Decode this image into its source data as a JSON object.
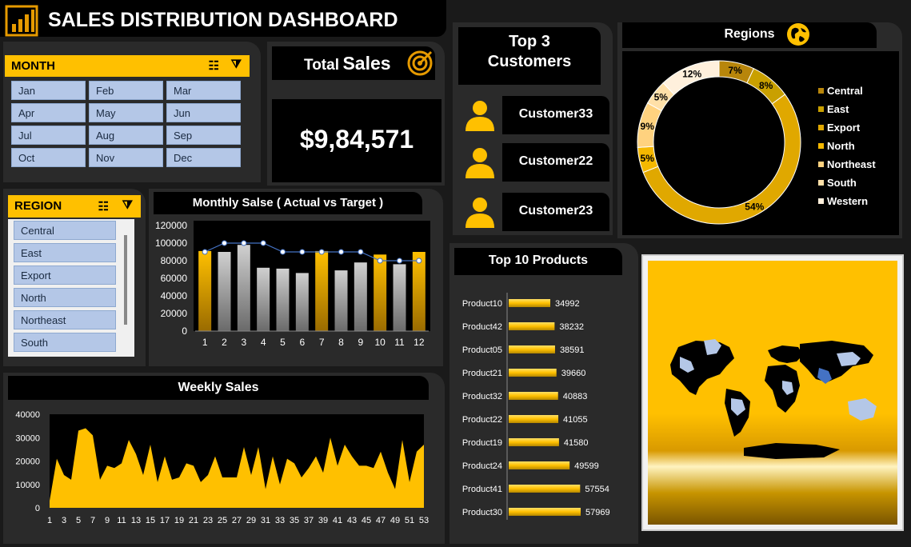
{
  "title": "SALES DISTRIBUTION DASHBOARD",
  "month_slicer": {
    "title": "MONTH",
    "items": [
      "Jan",
      "Feb",
      "Mar",
      "Apr",
      "May",
      "Jun",
      "Jul",
      "Aug",
      "Sep",
      "Oct",
      "Nov",
      "Dec"
    ]
  },
  "region_slicer": {
    "title": "REGION",
    "items": [
      "Central",
      "East",
      "Export",
      "North",
      "Northeast",
      "South"
    ]
  },
  "total_sales": {
    "label_small": "Total",
    "label_big": "Sales",
    "value": "$9,84,571"
  },
  "top_customers": {
    "title_line1": "Top 3",
    "title_line2": "Customers",
    "items": [
      "Customer33",
      "Customer22",
      "Customer23"
    ]
  },
  "regions": {
    "title": "Regions",
    "legend": [
      "Central",
      "East",
      "Export",
      "North",
      "Northeast",
      "South",
      "Western"
    ],
    "colors": [
      "#B8860B",
      "#C9A000",
      "#E0A800",
      "#F5B800",
      "#FFD27F",
      "#FFE0A8",
      "#FFF0DC"
    ]
  },
  "monthly": {
    "title": "Monthly Salse ( Actual vs Target )"
  },
  "weekly": {
    "title": "Weekly Sales"
  },
  "products": {
    "title": "Top 10 Products"
  },
  "chart_data": [
    {
      "type": "pie",
      "title": "Regions",
      "categories": [
        "Central",
        "East",
        "Export",
        "North",
        "Northeast",
        "South",
        "Western"
      ],
      "values": [
        7,
        8,
        54,
        5,
        9,
        5,
        12
      ],
      "labels": [
        "7%",
        "8%",
        "54%",
        "5%",
        "9%",
        "5%",
        "12%"
      ]
    },
    {
      "type": "bar",
      "title": "Monthly Salse ( Actual vs Target )",
      "categories": [
        "1",
        "2",
        "3",
        "4",
        "5",
        "6",
        "7",
        "8",
        "9",
        "10",
        "11",
        "12"
      ],
      "series": [
        {
          "values": [
            91000,
            90000,
            98000,
            72000,
            71000,
            66000,
            91000,
            69000,
            78000,
            87000,
            76000,
            90000
          ]
        },
        {
          "values": [
            90000,
            100000,
            100000,
            100000,
            90000,
            90000,
            90000,
            90000,
            90000,
            80000,
            80000,
            80000
          ]
        }
      ],
      "highlight": [
        1,
        7,
        10,
        12
      ],
      "yticks": [
        "0",
        "20000",
        "40000",
        "60000",
        "80000",
        "100000",
        "120000"
      ],
      "ylim": [
        0,
        120000
      ]
    },
    {
      "type": "area",
      "title": "Weekly Sales",
      "x": [
        1,
        2,
        3,
        4,
        5,
        6,
        7,
        8,
        9,
        10,
        11,
        12,
        13,
        14,
        15,
        16,
        17,
        18,
        19,
        20,
        21,
        22,
        23,
        24,
        25,
        26,
        27,
        28,
        29,
        30,
        31,
        32,
        33,
        34,
        35,
        36,
        37,
        38,
        39,
        40,
        41,
        42,
        43,
        44,
        45,
        46,
        47,
        48,
        49,
        50,
        51,
        52,
        53
      ],
      "xticks": [
        "1",
        "3",
        "5",
        "7",
        "9",
        "11",
        "13",
        "15",
        "17",
        "19",
        "21",
        "23",
        "25",
        "27",
        "29",
        "31",
        "33",
        "35",
        "37",
        "39",
        "41",
        "43",
        "45",
        "47",
        "49",
        "51",
        "53"
      ],
      "values": [
        3000,
        21000,
        14000,
        12000,
        33000,
        34000,
        31000,
        12000,
        18000,
        17000,
        19000,
        29000,
        23000,
        14000,
        27000,
        11000,
        22000,
        12000,
        13000,
        19000,
        18000,
        11000,
        14000,
        22000,
        13000,
        13000,
        13000,
        26000,
        14000,
        26000,
        8000,
        22000,
        10000,
        21000,
        19000,
        13000,
        17000,
        22000,
        15000,
        30000,
        18000,
        27000,
        22000,
        18000,
        18000,
        17000,
        24000,
        15000,
        8000,
        29000,
        11000,
        24000,
        27000
      ],
      "yticks": [
        "0",
        "10000",
        "20000",
        "30000",
        "40000"
      ],
      "ylim": [
        0,
        40000
      ]
    },
    {
      "type": "bar",
      "title": "Top 10 Products",
      "orientation": "horizontal",
      "categories": [
        "Product10",
        "Product42",
        "Product05",
        "Product21",
        "Product32",
        "Product22",
        "Product19",
        "Product24",
        "Product41",
        "Product30"
      ],
      "values": [
        34992,
        38232,
        38591,
        39660,
        40883,
        41055,
        41580,
        49599,
        57554,
        57969
      ],
      "labels": [
        "34992",
        "38232",
        "38591",
        "39660",
        "40883",
        "41055",
        "41580",
        "49599",
        "57554",
        "57969"
      ]
    }
  ]
}
